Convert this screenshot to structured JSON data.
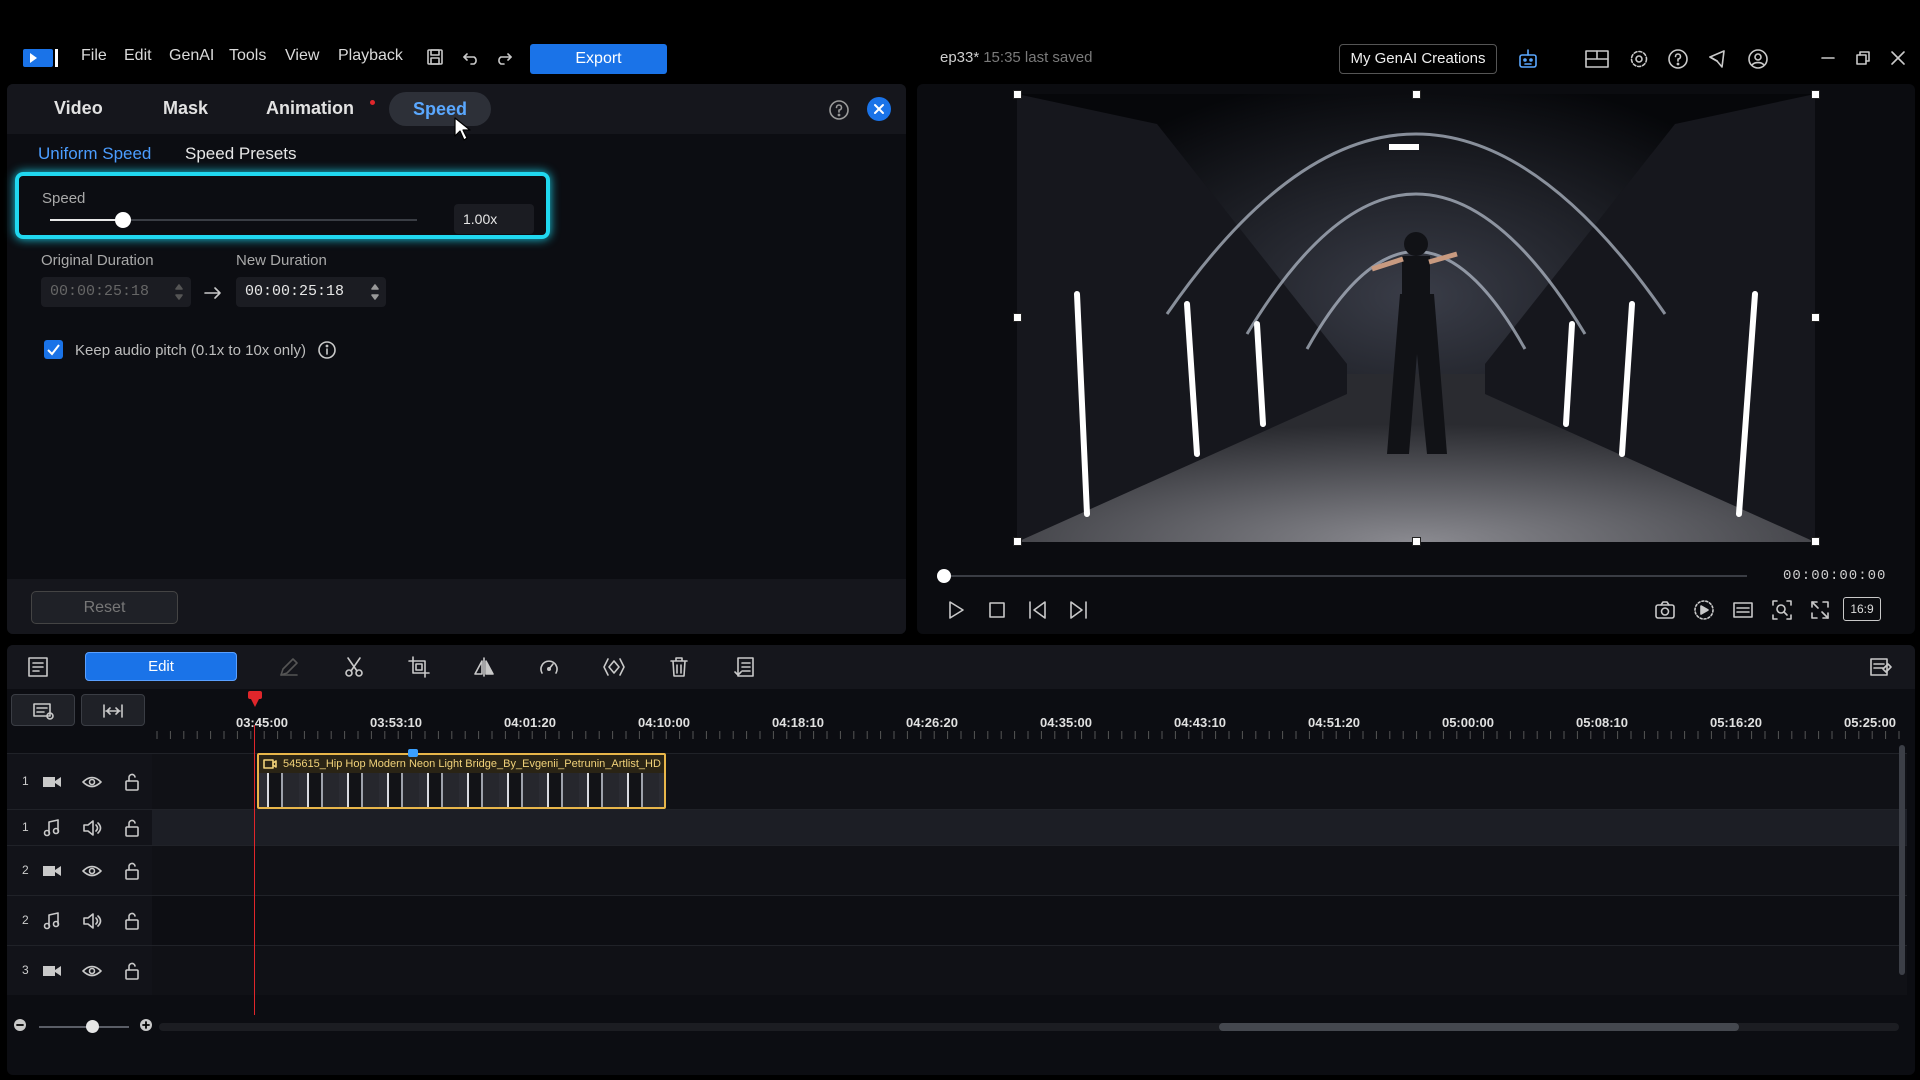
{
  "app": {
    "menu": [
      "File",
      "Edit",
      "GenAI",
      "Tools",
      "View",
      "Playback"
    ],
    "export_label": "Export",
    "project_name": "ep33*",
    "project_saved": "15:35 last saved",
    "genai_button": "My GenAI Creations"
  },
  "panel": {
    "tabs": {
      "video": "Video",
      "mask": "Mask",
      "animation": "Animation",
      "speed": "Speed"
    },
    "subtabs": {
      "uniform": "Uniform Speed",
      "presets": "Speed Presets"
    },
    "speed_label": "Speed",
    "speed_value": "1.00x",
    "speed_slider_fraction": 0.2,
    "original_duration_label": "Original Duration",
    "original_duration": "00:00:25:18",
    "new_duration_label": "New Duration",
    "new_duration": "00:00:25:18",
    "keep_pitch_label": "Keep audio pitch (0.1x to 10x only)",
    "keep_pitch_checked": true,
    "reset_label": "Reset"
  },
  "preview": {
    "timecode": "00:00:00:00",
    "aspect": "16:9"
  },
  "timeline": {
    "edit_label": "Edit",
    "ruler": [
      "03:45:00",
      "03:53:10",
      "04:01:20",
      "04:10:00",
      "04:18:10",
      "04:26:20",
      "04:35:00",
      "04:43:10",
      "04:51:20",
      "05:00:00",
      "05:08:10",
      "05:16:20",
      "05:25:00"
    ],
    "tracks": [
      {
        "num": "1",
        "type": "video"
      },
      {
        "num": "1",
        "type": "audio"
      },
      {
        "num": "2",
        "type": "video"
      },
      {
        "num": "2",
        "type": "audio"
      },
      {
        "num": "3",
        "type": "video"
      }
    ],
    "clip_title": "545615_Hip Hop Modern Neon Light Bridge_By_Evgenii_Petrunin_Artlist_HD"
  },
  "colors": {
    "accent": "#1a73e8",
    "highlight": "#20d8f0",
    "playhead": "#e0262b",
    "clip_border": "#e8b64a"
  }
}
